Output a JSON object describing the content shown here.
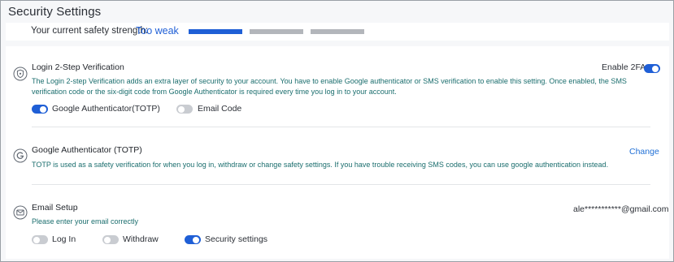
{
  "page": {
    "title": "Security Settings"
  },
  "strength": {
    "label": "Your current safety strength:",
    "value": "Too weak",
    "level_segments_filled": 1,
    "level_segments_total": 3
  },
  "colors": {
    "accent": "#1f5fd6",
    "description": "#1b6e6e",
    "inactive": "#b3b6bb"
  },
  "twofa": {
    "icon": "shield-icon",
    "title": "Login 2-Step Verification",
    "description_line1": "The Login 2-step Verification adds an extra layer of security to your account. You have to enable Google authenticator or SMS verification to enable this setting. Once enabled, the SMS",
    "description_line2": "verification code or the six-digit code from Google Authenticator is required every time you log in to your account.",
    "enable_label": "Enable 2FA",
    "enable_on": true,
    "options": [
      {
        "label": "Google Authenticator(TOTP)",
        "on": true
      },
      {
        "label": "Email Code",
        "on": false
      }
    ]
  },
  "totp": {
    "icon": "google-icon",
    "title": "Google Authenticator (TOTP)",
    "description": "TOTP is used as a safety verification for when you log in, withdraw or change safety settings. If you have trouble receiving SMS codes, you can use google authentication instead.",
    "action_label": "Change"
  },
  "email": {
    "icon": "mail-icon",
    "title": "Email Setup",
    "description": "Please enter your email correctly",
    "address": "ale***********@gmail.com",
    "options": [
      {
        "label": "Log In",
        "on": false
      },
      {
        "label": "Withdraw",
        "on": false
      },
      {
        "label": "Security settings",
        "on": true
      }
    ]
  }
}
